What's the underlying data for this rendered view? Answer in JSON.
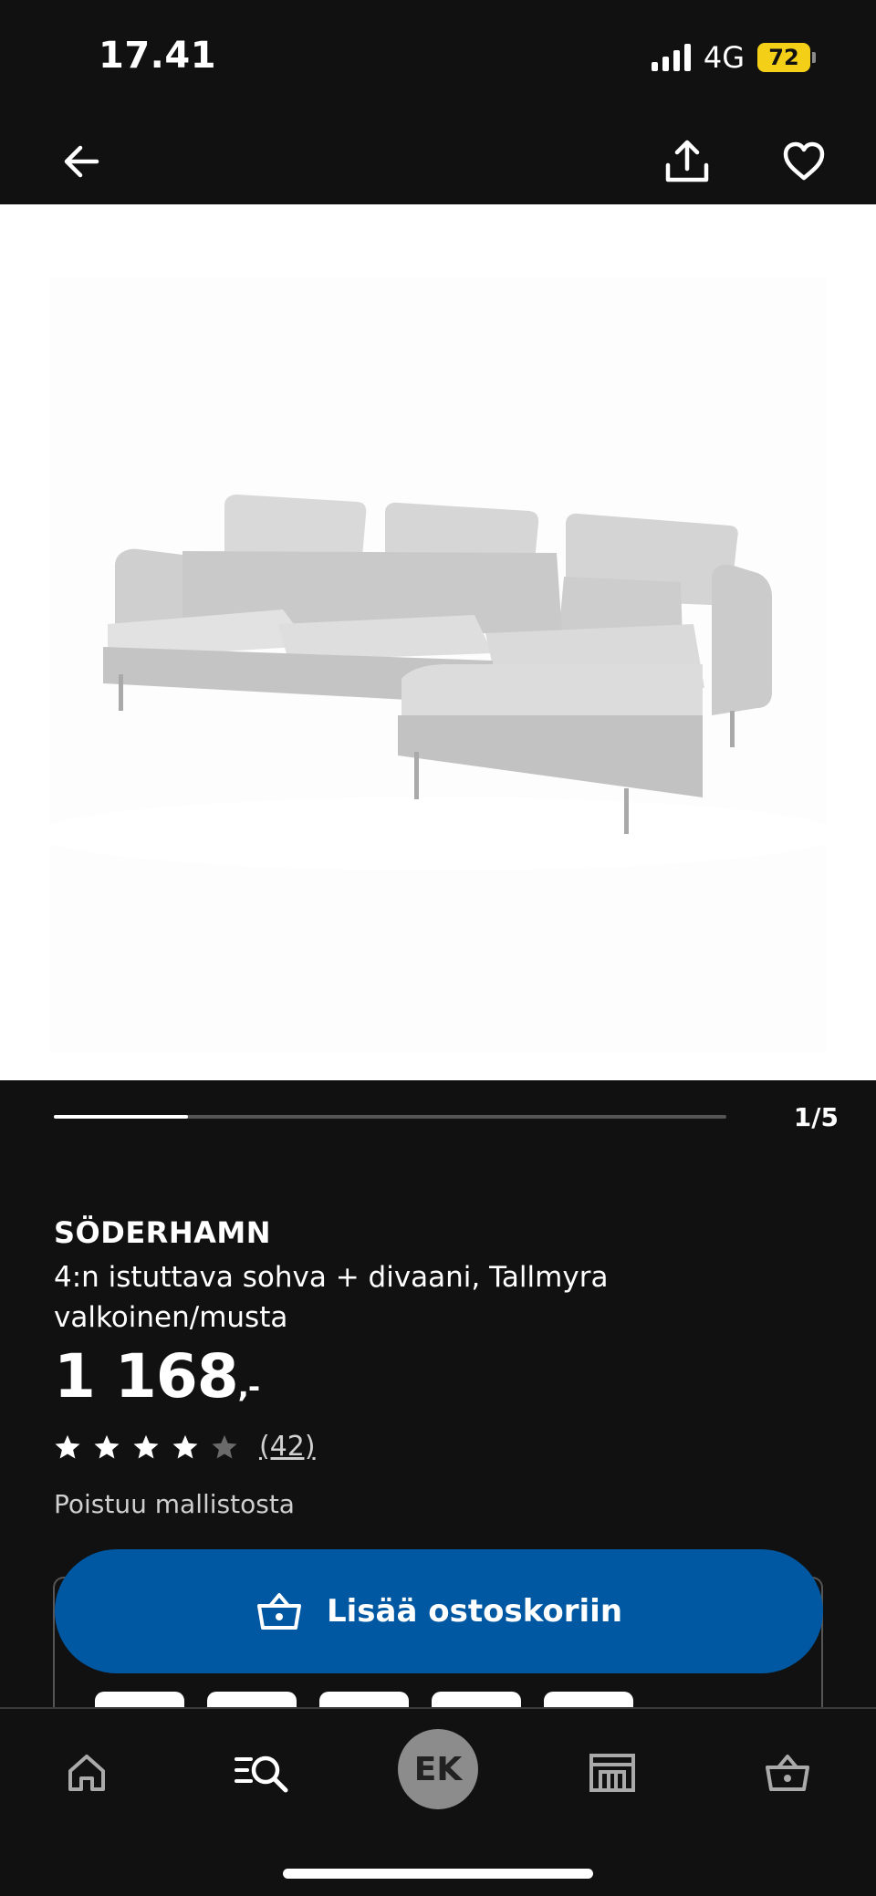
{
  "status_bar": {
    "time": "17.41",
    "network": "4G",
    "battery": "72"
  },
  "nav": {
    "back_icon": "arrow-left-icon",
    "share_icon": "share-icon",
    "favorite_icon": "heart-icon"
  },
  "gallery": {
    "counter": "1/5",
    "progress": 0.2
  },
  "product": {
    "brand": "SÖDERHAMN",
    "description": "4:n istuttava sohva + divaani, Tallmyra valkoinen/musta",
    "price": "1 168",
    "price_suffix": ",-",
    "rating": 4,
    "rating_max": 5,
    "review_count": "(42)",
    "availability": "Poistuu mallistosta"
  },
  "cart_button": {
    "label": "Lisää ostoskoriin",
    "icon": "basket-icon"
  },
  "tabs": [
    {
      "name": "home",
      "icon": "home-icon"
    },
    {
      "name": "search",
      "icon": "search-list-icon"
    },
    {
      "name": "profile",
      "label": "EK"
    },
    {
      "name": "stores",
      "icon": "store-icon"
    },
    {
      "name": "cart",
      "icon": "basket-icon"
    }
  ],
  "colors": {
    "accent": "#0058a3",
    "background": "#111111",
    "battery": "#f3cf17"
  }
}
